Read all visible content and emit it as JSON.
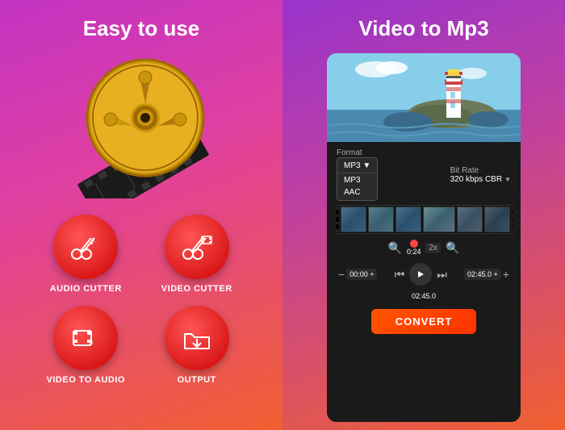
{
  "left": {
    "title": "Easy to use",
    "buttons": [
      {
        "id": "audio-cutter",
        "label": "AUDIO CUTTER",
        "icon": "scissors-music"
      },
      {
        "id": "video-cutter",
        "label": "VIDEO CUTTER",
        "icon": "scissors-film"
      },
      {
        "id": "video-audio",
        "label": "VIDEO TO AUDIO",
        "icon": "film-music"
      },
      {
        "id": "output",
        "label": "OUTPUT",
        "icon": "folder-download"
      }
    ]
  },
  "right": {
    "title": "Video to Mp3",
    "format": {
      "label": "Format",
      "selected": "MP3",
      "options": [
        "MP3",
        "AAC"
      ]
    },
    "bitrate": {
      "label": "Bit Rate",
      "selected": "320 kbps CBR"
    },
    "timeline": {
      "current_time": "0:24",
      "zoom_level": "2x",
      "start_time": "00:00 +",
      "end_time": "02:45.0 +",
      "duration": "02:45.0"
    },
    "convert_button": "CONVERT"
  }
}
